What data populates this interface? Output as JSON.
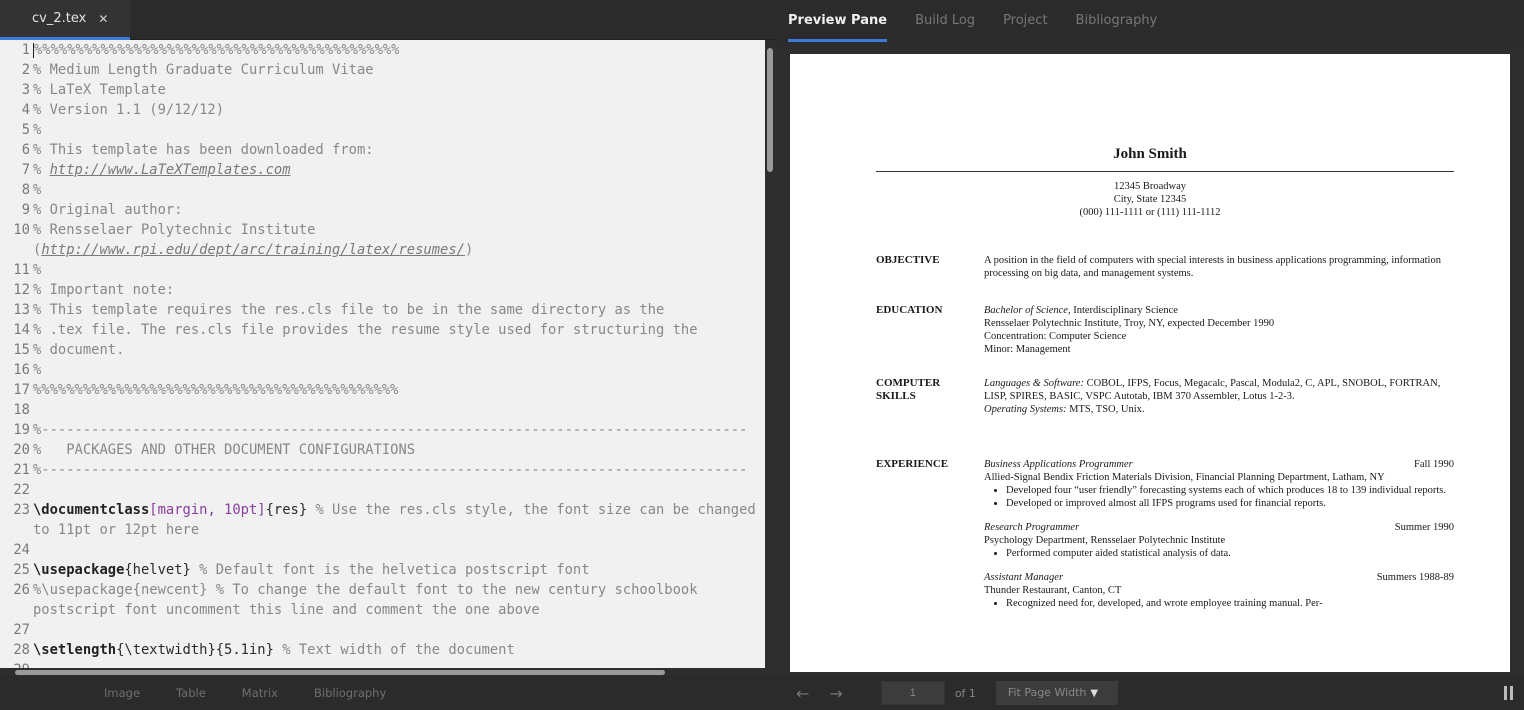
{
  "editor": {
    "file_tab": {
      "label": "cv_2.tex",
      "close": "✕"
    },
    "lines": [
      {
        "n": "1",
        "kind": "comment",
        "text": "%%%%%%%%%%%%%%%%%%%%%%%%%%%%%%%%%%%%%%%%%%%%",
        "cursor": true
      },
      {
        "n": "2",
        "kind": "comment",
        "text": "% Medium Length Graduate Curriculum Vitae"
      },
      {
        "n": "3",
        "kind": "comment",
        "text": "% LaTeX Template"
      },
      {
        "n": "4",
        "kind": "comment",
        "text": "% Version 1.1 (9/12/12)"
      },
      {
        "n": "5",
        "kind": "comment",
        "text": "%"
      },
      {
        "n": "6",
        "kind": "comment",
        "text": "% This template has been downloaded from:"
      },
      {
        "n": "7",
        "kind": "url",
        "prefix": "% ",
        "url": "http://www.LaTeXTemplates.com"
      },
      {
        "n": "8",
        "kind": "comment",
        "text": "%"
      },
      {
        "n": "9",
        "kind": "comment",
        "text": "% Original author:"
      },
      {
        "n": "10",
        "kind": "url2",
        "prefix": "% Rensselaer Polytechnic Institute (",
        "url": "http://www.rpi.edu/dept/arc/training/latex/resumes/",
        "suffix": ")"
      },
      {
        "n": "11",
        "kind": "comment",
        "text": "%"
      },
      {
        "n": "12",
        "kind": "comment",
        "text": "% Important note:"
      },
      {
        "n": "13",
        "kind": "comment",
        "text": "% This template requires the res.cls file to be in the same directory as the"
      },
      {
        "n": "14",
        "kind": "comment",
        "text": "% .tex file. The res.cls file provides the resume style used for structuring the"
      },
      {
        "n": "15",
        "kind": "comment",
        "text": "% document."
      },
      {
        "n": "16",
        "kind": "comment",
        "text": "%"
      },
      {
        "n": "17",
        "kind": "comment",
        "text": "%%%%%%%%%%%%%%%%%%%%%%%%%%%%%%%%%%%%%%%%%%%%"
      },
      {
        "n": "18",
        "kind": "blank",
        "text": ""
      },
      {
        "n": "19",
        "kind": "comment",
        "text": "%-------------------------------------------------------------------------------------"
      },
      {
        "n": "20",
        "kind": "comment",
        "text": "%   PACKAGES AND OTHER DOCUMENT CONFIGURATIONS"
      },
      {
        "n": "21",
        "kind": "comment",
        "text": "%-------------------------------------------------------------------------------------"
      },
      {
        "n": "22",
        "kind": "blank",
        "text": ""
      },
      {
        "n": "23",
        "kind": "cmd",
        "cmd": "\\documentclass",
        "opt": "[margin, 10pt]",
        "arg": "{res}",
        "comment": " % Use the res.cls style, the font size can be changed to 11pt or 12pt here"
      },
      {
        "n": "24",
        "kind": "blank",
        "text": ""
      },
      {
        "n": "25",
        "kind": "cmd",
        "cmd": "\\usepackage",
        "opt": "",
        "arg": "{helvet}",
        "comment": " % Default font is the helvetica postscript font"
      },
      {
        "n": "26",
        "kind": "comment",
        "text": "%\\usepackage{newcent} % To change the default font to the new century schoolbook postscript font uncomment this line and comment the one above"
      },
      {
        "n": "27",
        "kind": "blank",
        "text": ""
      },
      {
        "n": "28",
        "kind": "cmd",
        "cmd": "\\setlength",
        "opt": "",
        "arg": "{\\textwidth}{5.1in}",
        "comment": " % Text width of the document"
      },
      {
        "n": "29",
        "kind": "blank",
        "text": ""
      }
    ],
    "toolbar": [
      "Image",
      "Table",
      "Matrix",
      "Bibliography"
    ]
  },
  "preview": {
    "tabs": [
      "Preview Pane",
      "Build Log",
      "Project",
      "Bibliography"
    ],
    "active_tab": 0,
    "page_input": "1",
    "page_of": "of 1",
    "zoom": "Fit Page Width"
  },
  "pdf": {
    "name": "John Smith",
    "address": [
      "12345 Broadway",
      "City, State 12345",
      "(000) 111-1111 or (111) 111-1112"
    ],
    "objective": {
      "heading": "OBJECTIVE",
      "text": "A position in the field of computers with special interests in business applications programming, information processing on big data, and management systems."
    },
    "education": {
      "heading": "EDUCATION",
      "degree": "Bachelor of Science,",
      "degree_rest": " Interdisciplinary Science",
      "lines": [
        "Rensselaer Polytechnic Institute, Troy, NY, expected December 1990",
        "Concentration: Computer Science",
        "Minor: Management"
      ]
    },
    "skills": {
      "heading1": "COMPUTER",
      "heading2": "SKILLS",
      "lang_label": "Languages & Software:",
      "lang_text": " COBOL, IFPS, Focus, Megacalc, Pascal, Modula2, C, APL, SNOBOL, FORTRAN, LISP, SPIRES, BASIC, VSPC Autotab, IBM 370 Assembler, Lotus 1-2-3.",
      "os_label": "Operating Systems:",
      "os_text": " MTS, TSO, Unix."
    },
    "experience": {
      "heading": "EXPERIENCE",
      "jobs": [
        {
          "title": "Business Applications Programmer",
          "date": "Fall 1990",
          "org": "Allied-Signal Bendix Friction Materials Division, Financial Planning Department, Latham, NY",
          "bullets": [
            "Developed four “user friendly” forecasting systems each of which produces 18 to 139 individual reports.",
            "Developed or improved almost all IFPS programs used for financial reports."
          ]
        },
        {
          "title": "Research Programmer",
          "date": "Summer 1990",
          "org": "Psychology Department, Rensselaer Polytechnic Institute",
          "bullets": [
            "Performed computer aided statistical analysis of data."
          ]
        },
        {
          "title": "Assistant Manager",
          "date": "Summers 1988-89",
          "org": "Thunder Restaurant, Canton, CT",
          "bullets": [
            "Recognized need for, developed, and wrote employee training manual. Per-"
          ]
        }
      ]
    }
  },
  "colors": {
    "accent": "#3d7bd9",
    "editor_bg": "#f1f1f1",
    "chrome": "#2b2b2b",
    "marker": "#e07a1f"
  },
  "icons": {
    "close": "close-icon",
    "prev": "arrow-left-icon",
    "next": "arrow-right-icon",
    "zoom_caret": "caret-down-icon",
    "pause": "pause-icon"
  }
}
